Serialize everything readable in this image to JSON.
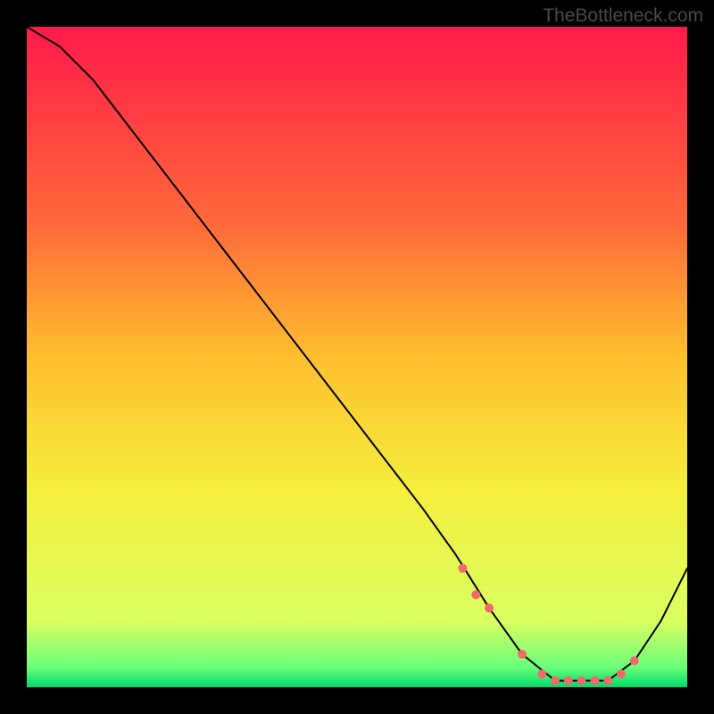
{
  "watermark": "TheBottleneck.com",
  "chart_data": {
    "type": "line",
    "title": "",
    "xlabel": "",
    "ylabel": "",
    "xlim": [
      0,
      100
    ],
    "ylim": [
      0,
      100
    ],
    "gradient_stops": [
      {
        "offset": 0,
        "color": "#ff1a4a"
      },
      {
        "offset": 30,
        "color": "#ff6a3a"
      },
      {
        "offset": 50,
        "color": "#ffbf2e"
      },
      {
        "offset": 70,
        "color": "#f5ee3e"
      },
      {
        "offset": 90,
        "color": "#daff60"
      },
      {
        "offset": 97,
        "color": "#6aff7a"
      },
      {
        "offset": 100,
        "color": "#00d96a"
      }
    ],
    "series": [
      {
        "name": "bottleneck-curve",
        "color": "#000000",
        "stroke_width": 2,
        "x": [
          0,
          5,
          10,
          20,
          30,
          40,
          50,
          60,
          65,
          70,
          75,
          80,
          85,
          88,
          92,
          96,
          100
        ],
        "values": [
          100,
          97,
          92,
          79,
          66,
          53,
          40,
          27,
          20,
          12,
          5,
          1,
          1,
          1,
          4,
          10,
          18
        ]
      }
    ],
    "markers": {
      "name": "highlight-points",
      "color": "#f06a6a",
      "radius": 5,
      "x": [
        66,
        68,
        70,
        75,
        78,
        80,
        82,
        84,
        86,
        88,
        90,
        92
      ],
      "values": [
        18,
        14,
        12,
        5,
        2,
        1,
        1,
        1,
        1,
        1,
        2,
        4
      ]
    }
  }
}
